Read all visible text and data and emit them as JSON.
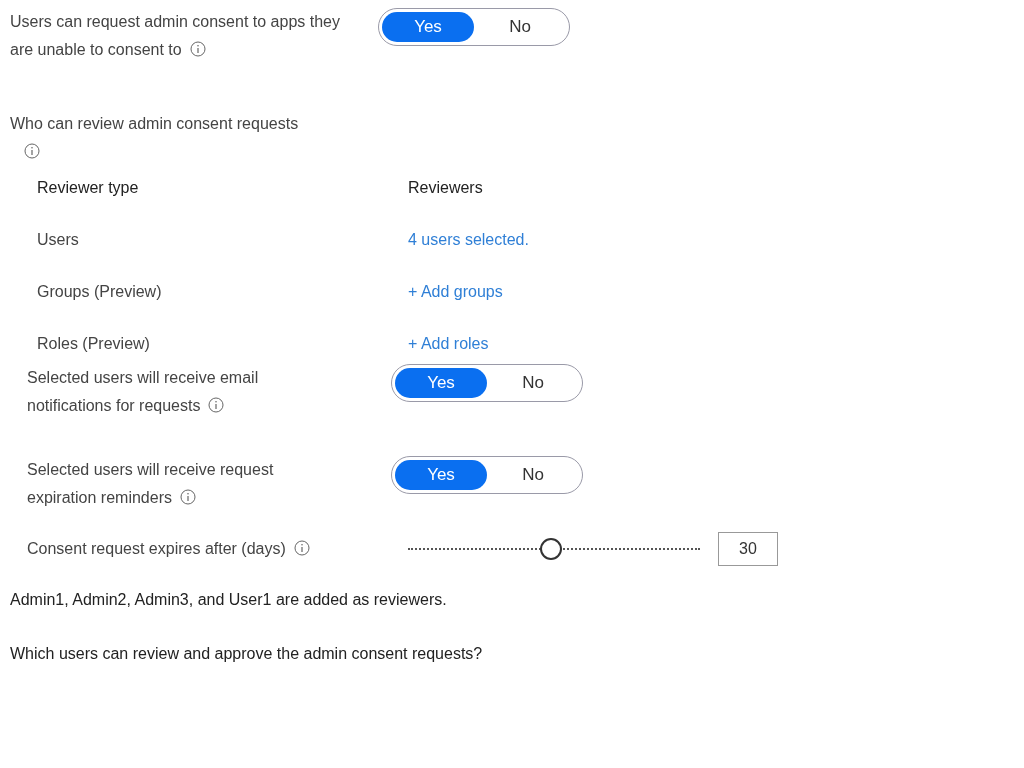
{
  "consent_setting": {
    "label": "Users can request admin consent to apps they are unable to consent to",
    "options": [
      {
        "label": "Yes",
        "selected": true
      },
      {
        "label": "No",
        "selected": false
      }
    ]
  },
  "reviewers": {
    "label": "Who can review admin consent requests",
    "columns": [
      "Reviewer type",
      "Reviewers"
    ],
    "rows": [
      {
        "type": "Users",
        "reviewers": "4 users selected."
      },
      {
        "type": "Groups (Preview)",
        "reviewers": "+ Add groups"
      },
      {
        "type": "Roles (Preview)",
        "reviewers": "+ Add roles"
      }
    ]
  },
  "settings": [
    {
      "label": "Selected users will receive email notifications for requests",
      "options": [
        {
          "label": "Yes",
          "selected": true
        },
        {
          "label": "No",
          "selected": false
        }
      ]
    },
    {
      "label": "Selected users will receive request expiration reminders",
      "options": [
        {
          "label": "Yes",
          "selected": true
        },
        {
          "label": "No",
          "selected": false
        }
      ]
    }
  ],
  "expiry": {
    "label": "Consent request expires after (days)",
    "level": 0.49,
    "value": "30"
  },
  "statement": "Admin1, Admin2, Admin3, and User1 are added as reviewers.",
  "question": "Which users can review and approve the admin consent requests?"
}
